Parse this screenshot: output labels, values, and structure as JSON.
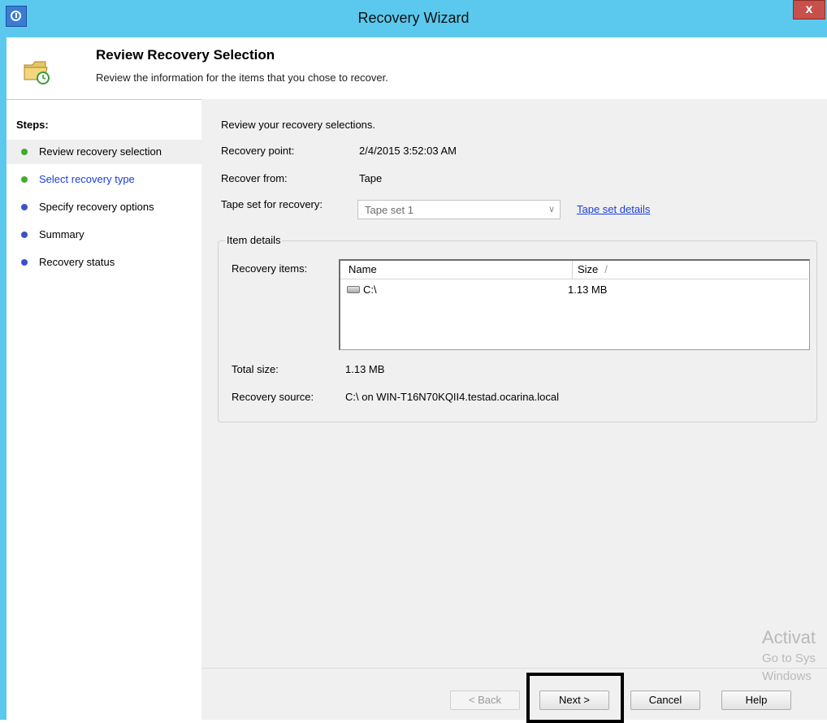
{
  "window": {
    "title": "Recovery Wizard",
    "close_label": "x"
  },
  "header": {
    "title": "Review Recovery Selection",
    "subtitle": "Review the information for the items that you chose to recover."
  },
  "steps": {
    "heading": "Steps:",
    "items": [
      {
        "label": "Review recovery selection",
        "state": "current",
        "dot_color": "#3fae2a"
      },
      {
        "label": "Select recovery type",
        "state": "link",
        "dot_color": "#3fae2a"
      },
      {
        "label": "Specify recovery options",
        "state": "pending",
        "dot_color": "#3a52c8"
      },
      {
        "label": "Summary",
        "state": "pending",
        "dot_color": "#3a52c8"
      },
      {
        "label": "Recovery status",
        "state": "pending",
        "dot_color": "#3a52c8"
      }
    ]
  },
  "main": {
    "intro": "Review your recovery selections.",
    "recovery_point_label": "Recovery point:",
    "recovery_point_value": "2/4/2015 3:52:03 AM",
    "recover_from_label": "Recover from:",
    "recover_from_value": "Tape",
    "tape_set_label": "Tape set for recovery:",
    "tape_set_value": "Tape set 1",
    "tape_set_link": "Tape set details",
    "item_details": {
      "title": "Item details",
      "recovery_items_label": "Recovery items:",
      "columns": [
        "Name",
        "Size"
      ],
      "sort_indicator": "/",
      "rows": [
        {
          "name": "C:\\",
          "size": "1.13 MB",
          "icon": "drive-icon"
        }
      ],
      "total_size_label": "Total size:",
      "total_size_value": "1.13 MB",
      "recovery_source_label": "Recovery source:",
      "recovery_source_value": "C:\\ on WIN-T16N70KQII4.testad.ocarina.local"
    }
  },
  "buttons": {
    "back": "< Back",
    "next": "Next >",
    "cancel": "Cancel",
    "help": "Help"
  },
  "watermark": {
    "line1": "Activat",
    "line2": "Go to Sys",
    "line3": "Windows"
  }
}
